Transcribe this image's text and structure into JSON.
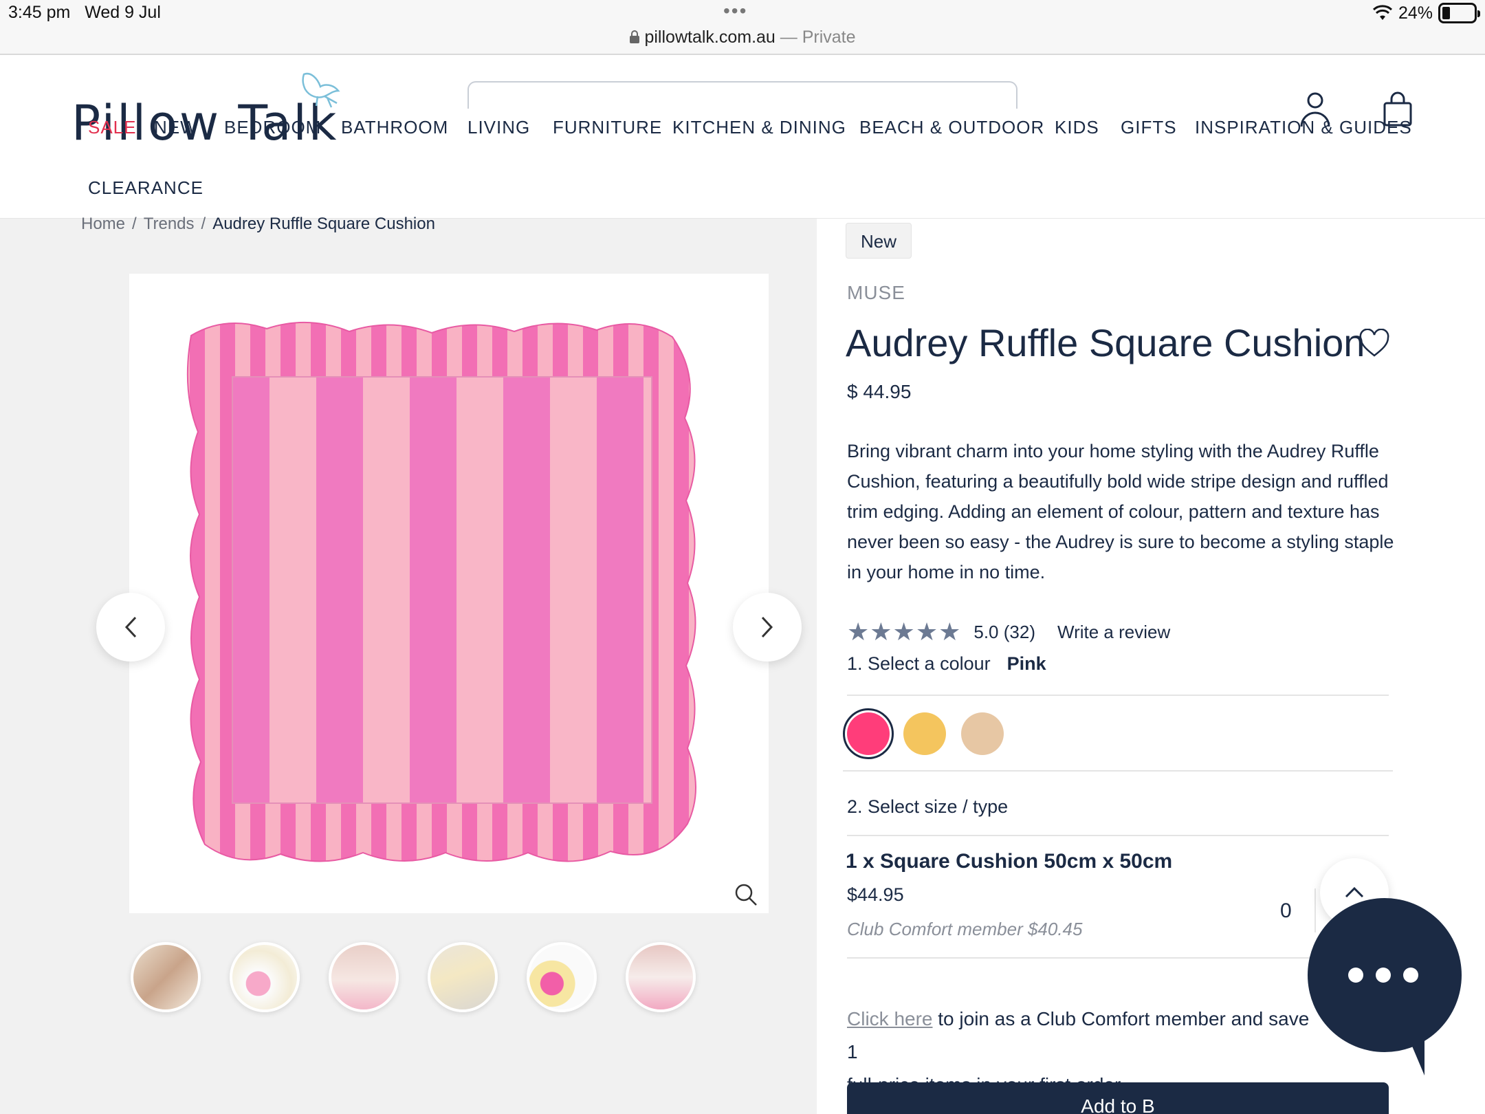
{
  "status_bar": {
    "time": "3:45 pm",
    "date": "Wed 9 Jul",
    "dots": "•••",
    "url": "pillowtalk.com.au",
    "url_suffix": " — Private",
    "battery": "24%"
  },
  "header": {
    "logo": "Pillow Talk",
    "nav": [
      "SALE",
      "NEW",
      "BEDROOM",
      "BATHROOM",
      "LIVING",
      "FURNITURE",
      "KITCHEN & DINING",
      "BEACH & OUTDOOR",
      "KIDS",
      "GIFTS",
      "INSPIRATION & GUIDES",
      "CLEARANCE"
    ]
  },
  "breadcrumb": [
    "Home",
    "Trends",
    "Audrey Ruffle Square Cushion"
  ],
  "breadcrumb_sep": "/",
  "product": {
    "badge": "New",
    "brand": "MUSE",
    "title": "Audrey Ruffle Square Cushion",
    "price": "$ 44.95",
    "description": "Bring vibrant charm into your home styling with the Audrey Ruffle Cushion, featuring a beautifully bold wide stripe design and ruffled trim edging. Adding an element of colour, pattern and texture has never been so easy - the Audrey is sure to become a styling staple in your home in no time.",
    "rating_stars": "★★★★★",
    "rating": "5.0",
    "review_count": "(32)",
    "write_review": "Write a review",
    "step1_label": "1. Select a colour",
    "selected_colour": "Pink",
    "swatches": [
      "#ff3d7a",
      "#f4c55e",
      "#e7c7a4"
    ],
    "step2_label": "2. Select size / type",
    "option_name": "1 x Square Cushion 50cm x 50cm",
    "option_price": "$44.95",
    "option_club_price": "Club Comfort member $40.45",
    "quantity": "0",
    "club_link": "Click here",
    "club_text": " to join as a Club Comfort member and save 1",
    "club_text2": "full-price items in your first order.",
    "add_button": "Add to B"
  },
  "colors": {
    "navy": "#1b2a44",
    "sale_red": "#e2304f",
    "gallery_bg": "#f1f1f1"
  }
}
